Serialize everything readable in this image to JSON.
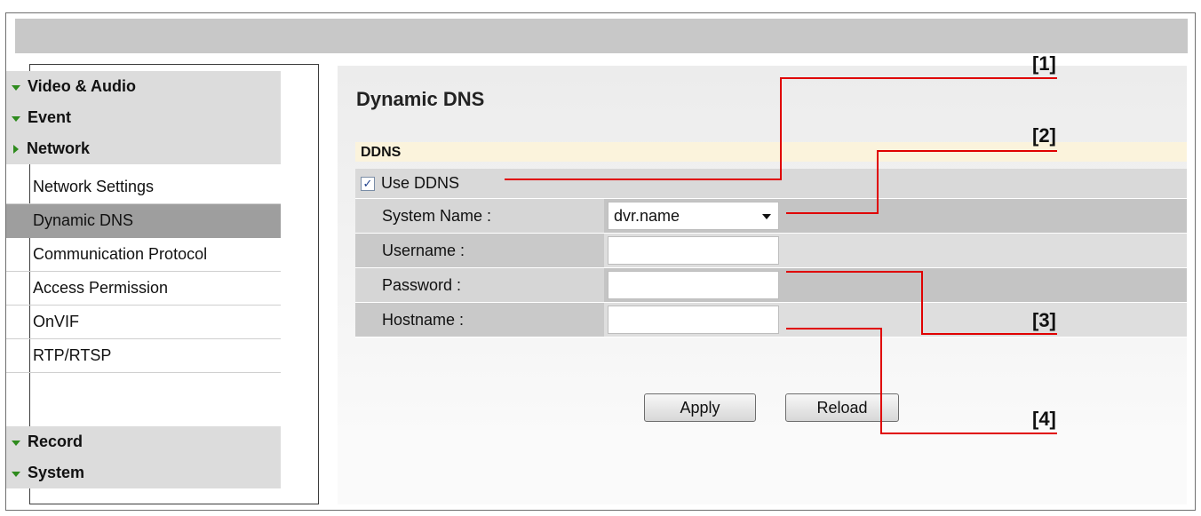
{
  "sidebar": {
    "categories_top": [
      {
        "label": "Video & Audio",
        "expanded": false
      },
      {
        "label": "Event",
        "expanded": false
      },
      {
        "label": "Network",
        "expanded": true
      }
    ],
    "sub_items": [
      {
        "label": "Network Settings",
        "active": false
      },
      {
        "label": "Dynamic DNS",
        "active": true
      },
      {
        "label": "Communication Protocol",
        "active": false
      },
      {
        "label": "Access Permission",
        "active": false
      },
      {
        "label": "OnVIF",
        "active": false
      },
      {
        "label": "RTP/RTSP",
        "active": false
      }
    ],
    "categories_bottom": [
      {
        "label": "Record"
      },
      {
        "label": "System"
      }
    ]
  },
  "main": {
    "title": "Dynamic DNS",
    "section_title": "DDNS",
    "use_ddns": {
      "label": "Use DDNS",
      "checked": true,
      "check_glyph": "✓"
    },
    "fields": {
      "system_name": {
        "label": "System Name :",
        "value": "dvr.name"
      },
      "username": {
        "label": "Username :",
        "value": ""
      },
      "password": {
        "label": "Password :",
        "value": ""
      },
      "hostname": {
        "label": "Hostname :",
        "value": ""
      }
    },
    "buttons": {
      "apply": "Apply",
      "reload": "Reload"
    }
  },
  "callouts": [
    "[1]",
    "[2]",
    "[3]",
    "[4]"
  ],
  "colors": {
    "callout_line": "#e00000",
    "expand_arrow": "#2e8b1d",
    "active_item": "#9e9e9e"
  }
}
